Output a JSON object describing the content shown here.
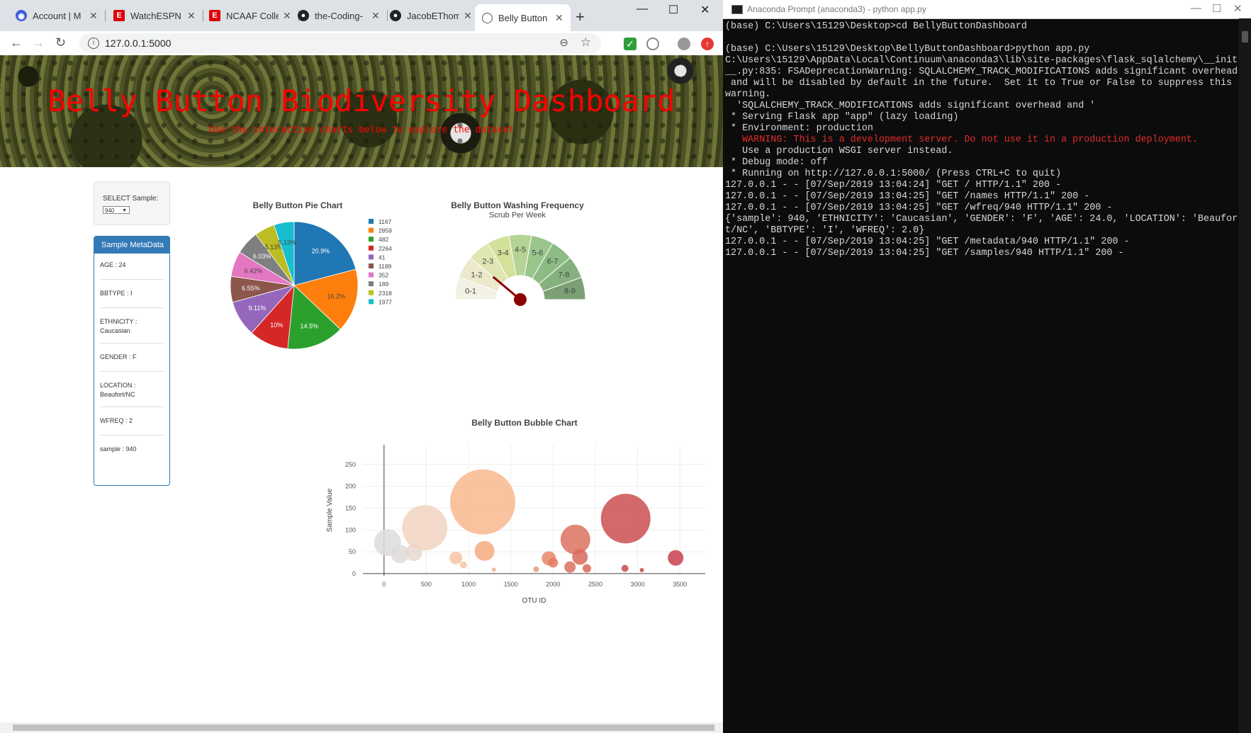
{
  "browser": {
    "tabs": [
      {
        "label": "Account | M",
        "icon": "circle-icon",
        "color": "#3b5cdb"
      },
      {
        "label": "WatchESPN",
        "icon": "espn-icon",
        "color": "#d00"
      },
      {
        "label": "NCAAF Colle",
        "icon": "espn-icon",
        "color": "#d00"
      },
      {
        "label": "the-Coding-",
        "icon": "github-icon",
        "color": "#222"
      },
      {
        "label": "JacobEThom",
        "icon": "github-icon",
        "color": "#222"
      },
      {
        "label": "Belly Button",
        "icon": "globe-icon",
        "color": "#555"
      }
    ],
    "url": "127.0.0.1:5000"
  },
  "page": {
    "title": "Belly Button Biodiversity Dashboard",
    "subtitle": "Use the interactive charts below to explore the dataset",
    "select_label": "SELECT Sample:",
    "select_value": "940",
    "metadata_heading": "Sample MetaData",
    "metadata": [
      {
        "text": "AGE : 24"
      },
      {
        "text": "BBTYPE : I"
      },
      {
        "text": "ETHNICITY : Caucasian"
      },
      {
        "text": "GENDER : F"
      },
      {
        "text": "LOCATION : Beaufort/NC"
      },
      {
        "text": "WFREQ : 2"
      },
      {
        "text": "sample : 940"
      }
    ]
  },
  "chart_data": [
    {
      "type": "pie",
      "title": "Belly Button Pie Chart",
      "labels": [
        "1167",
        "2859",
        "482",
        "2264",
        "41",
        "1189",
        "352",
        "189",
        "2318",
        "1977"
      ],
      "values": [
        20.9,
        16.2,
        14.5,
        10.0,
        9.11,
        6.55,
        6.42,
        6.03,
        5.13,
        5.13
      ],
      "value_labels": [
        "20.9%",
        "16.2%",
        "14.5%",
        "10%",
        "9.11%",
        "6.55%",
        "6.42%",
        "6.03%",
        "5.13%",
        "5.13%"
      ],
      "colors": [
        "#1f77b4",
        "#ff7f0e",
        "#2ca02c",
        "#d62728",
        "#9467bd",
        "#8c564b",
        "#e377c2",
        "#7f7f7f",
        "#bcbd22",
        "#17becf"
      ],
      "legend": "right"
    },
    {
      "type": "gauge",
      "title": "Belly Button Washing Frequency",
      "subtitle": "Scrub Per Week",
      "sectors": [
        "0-1",
        "1-2",
        "2-3",
        "3-4",
        "4-5",
        "5-6",
        "6-7",
        "7-8",
        "8-9"
      ],
      "sector_colors": [
        "#f3f1e4",
        "#ece9cc",
        "#e0e6b2",
        "#d4e19a",
        "#b5d394",
        "#9ac68c",
        "#8cbc84",
        "#86b17f",
        "#7c9f75"
      ],
      "range": [
        0,
        9
      ],
      "value": 2,
      "needle_color": "#8b0000"
    },
    {
      "type": "scatter",
      "title": "Belly Button Bubble Chart",
      "xlabel": "OTU ID",
      "ylabel": "Sample Value",
      "xticks": [
        0,
        500,
        1000,
        1500,
        2000,
        2500,
        3000,
        3500
      ],
      "yticks": [
        0,
        50,
        100,
        150,
        200,
        250
      ],
      "xlim": [
        -250,
        3800
      ],
      "ylim": [
        -5,
        295
      ],
      "grid": true,
      "points": [
        {
          "x": 41,
          "y": 71,
          "color": "#dcdcdc"
        },
        {
          "x": 189,
          "y": 45,
          "color": "#e0dada"
        },
        {
          "x": 352,
          "y": 48,
          "color": "#e8d8d0"
        },
        {
          "x": 482,
          "y": 105,
          "color": "#f1d3c1"
        },
        {
          "x": 850,
          "y": 36,
          "color": "#f6c4a4"
        },
        {
          "x": 940,
          "y": 20,
          "color": "#f6c4a4"
        },
        {
          "x": 1167,
          "y": 164,
          "color": "#f8b98e"
        },
        {
          "x": 1189,
          "y": 52,
          "color": "#f4aa80"
        },
        {
          "x": 1950,
          "y": 35,
          "color": "#e8866a"
        },
        {
          "x": 2000,
          "y": 25,
          "color": "#e37d63"
        },
        {
          "x": 2264,
          "y": 78,
          "color": "#dd715f"
        },
        {
          "x": 2318,
          "y": 38,
          "color": "#d86a5c"
        },
        {
          "x": 2200,
          "y": 15,
          "color": "#d9705d"
        },
        {
          "x": 2400,
          "y": 12,
          "color": "#d66858"
        },
        {
          "x": 2859,
          "y": 126,
          "color": "#cd4f4f"
        },
        {
          "x": 2850,
          "y": 12,
          "color": "#c94c4f"
        },
        {
          "x": 3450,
          "y": 36,
          "color": "#c7404e"
        },
        {
          "x": 1800,
          "y": 10,
          "color": "#e69a7a"
        },
        {
          "x": 1300,
          "y": 9,
          "color": "#f0b090"
        },
        {
          "x": 3050,
          "y": 8,
          "color": "#c84a4e"
        }
      ],
      "sizes": [
        38,
        26,
        24,
        64,
        18,
        10,
        92,
        28,
        20,
        14,
        42,
        22,
        16,
        12,
        70,
        10,
        22,
        8,
        6,
        6
      ]
    }
  ],
  "terminal": {
    "title": "Anaconda Prompt (anaconda3) - python  app.py",
    "lines": [
      {
        "text": "(base) C:\\Users\\15129\\Desktop>cd BellyButtonDashboard",
        "red": false
      },
      {
        "text": "",
        "red": false
      },
      {
        "text": "(base) C:\\Users\\15129\\Desktop\\BellyButtonDashboard>python app.py",
        "red": false
      },
      {
        "text": "C:\\Users\\15129\\AppData\\Local\\Continuum\\anaconda3\\lib\\site-packages\\flask_sqlalchemy\\__init",
        "red": false
      },
      {
        "text": "__.py:835: FSADeprecationWarning: SQLALCHEMY_TRACK_MODIFICATIONS adds significant overhead",
        "red": false
      },
      {
        "text": " and will be disabled by default in the future.  Set it to True or False to suppress this",
        "red": false
      },
      {
        "text": "warning.",
        "red": false
      },
      {
        "text": "  'SQLALCHEMY_TRACK_MODIFICATIONS adds significant overhead and '",
        "red": false
      },
      {
        "text": " * Serving Flask app \"app\" (lazy loading)",
        "red": false
      },
      {
        "text": " * Environment: production",
        "red": false
      },
      {
        "text": "   WARNING: This is a development server. Do not use it in a production deployment.",
        "red": true
      },
      {
        "text": "   Use a production WSGI server instead.",
        "red": false
      },
      {
        "text": " * Debug mode: off",
        "red": false
      },
      {
        "text": " * Running on http://127.0.0.1:5000/ (Press CTRL+C to quit)",
        "red": false
      },
      {
        "text": "127.0.0.1 - - [07/Sep/2019 13:04:24] \"GET / HTTP/1.1\" 200 -",
        "red": false
      },
      {
        "text": "127.0.0.1 - - [07/Sep/2019 13:04:25] \"GET /names HTTP/1.1\" 200 -",
        "red": false
      },
      {
        "text": "127.0.0.1 - - [07/Sep/2019 13:04:25] \"GET /wfreq/940 HTTP/1.1\" 200 -",
        "red": false
      },
      {
        "text": "{'sample': 940, 'ETHNICITY': 'Caucasian', 'GENDER': 'F', 'AGE': 24.0, 'LOCATION': 'Beaufor",
        "red": false
      },
      {
        "text": "t/NC', 'BBTYPE': 'I', 'WFREQ': 2.0}",
        "red": false
      },
      {
        "text": "127.0.0.1 - - [07/Sep/2019 13:04:25] \"GET /metadata/940 HTTP/1.1\" 200 -",
        "red": false
      },
      {
        "text": "127.0.0.1 - - [07/Sep/2019 13:04:25] \"GET /samples/940 HTTP/1.1\" 200 -",
        "red": false
      }
    ]
  }
}
